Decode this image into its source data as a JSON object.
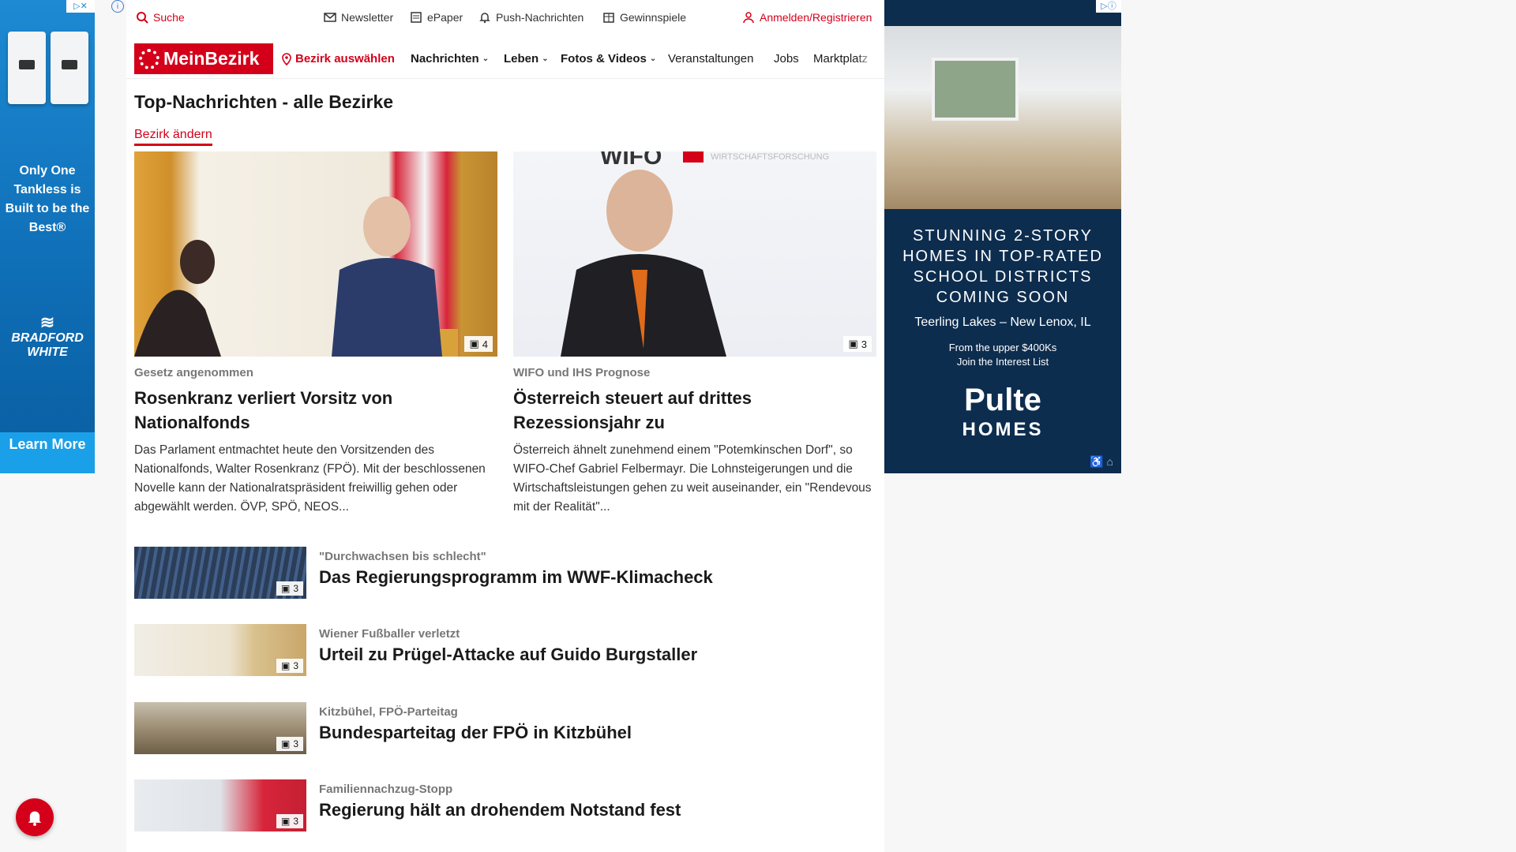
{
  "left_ad": {
    "tagline": "Only One Tankless is Built to be the Best®",
    "brand": "BRADFORD WHITE",
    "cta": "Learn More"
  },
  "utility_bar": {
    "search": "Suche",
    "newsletter": "Newsletter",
    "epaper": "ePaper",
    "push": "Push-Nachrichten",
    "gewinnspiele": "Gewinnspiele",
    "login": "Anmelden/Registrieren"
  },
  "nav": {
    "logo": "MeinBezirk",
    "bezirk": "Bezirk auswählen",
    "items": [
      "Nachrichten",
      "Leben",
      "Fotos & Videos",
      "Veranstaltungen",
      "Jobs",
      "Marktplatz"
    ]
  },
  "section": {
    "title": "Top-Nachrichten - alle Bezirke",
    "change_link": "Bezirk ändern"
  },
  "featured": [
    {
      "kicker": "Gesetz angenommen",
      "headline": "Rosenkranz verliert Vorsitz von Nationalfonds",
      "teaser": "Das Parlament entmachtet heute den Vorsitzenden des Nationalfonds, Walter Rosenkranz (FPÖ). Mit der beschlossenen Novelle kann der Nationalratspräsident freiwillig gehen oder abgewählt werden. ÖVP, SPÖ, NEOS...",
      "photo_count": "4"
    },
    {
      "kicker": "WIFO und IHS Prognose",
      "headline": "Österreich steuert auf drittes Rezessionsjahr zu",
      "teaser": "Österreich ähnelt zunehmend einem \"Potemkinschen Dorf\", so WIFO-Chef Gabriel Felbermayr. Die Lohnsteigerungen und die Wirtschaftsleistungen gehen zu weit auseinander, ein \"Rendevous mit der Realität\"...",
      "photo_count": "3",
      "photo_text": "WIFO",
      "photo_subtext": "WIRTSCHAFTSFORSCHUNG"
    }
  ],
  "list": [
    {
      "kicker": "\"Durchwachsen bis schlecht\"",
      "headline": "Das Regierungsprogramm im WWF-Klimacheck",
      "photo_count": "3"
    },
    {
      "kicker": "Wiener Fußballer verletzt",
      "headline": "Urteil zu Prügel-Attacke auf Guido Burgstaller",
      "photo_count": "3"
    },
    {
      "kicker": "Kitzbühel, FPÖ-Parteitag",
      "headline": "Bundesparteitag der FPÖ in Kitzbühel",
      "photo_count": "3"
    },
    {
      "kicker": "Familiennachzug-Stopp",
      "headline": "Regierung hält an drohendem Notstand fest",
      "photo_count": "3"
    }
  ],
  "right_ad": {
    "headline": "STUNNING 2-STORY HOMES IN TOP-RATED SCHOOL DISTRICTS COMING SOON",
    "place": "Teerling Lakes – New Lenox, IL",
    "price_line1": "From the upper $400Ks",
    "price_line2": "Join the Interest List",
    "brand1": "Pulte",
    "brand2": "HOMES"
  },
  "colors": {
    "brand_red": "#d4001a",
    "ad_blue": "#1d8ad3",
    "ad_navy": "#0d2d4f"
  }
}
